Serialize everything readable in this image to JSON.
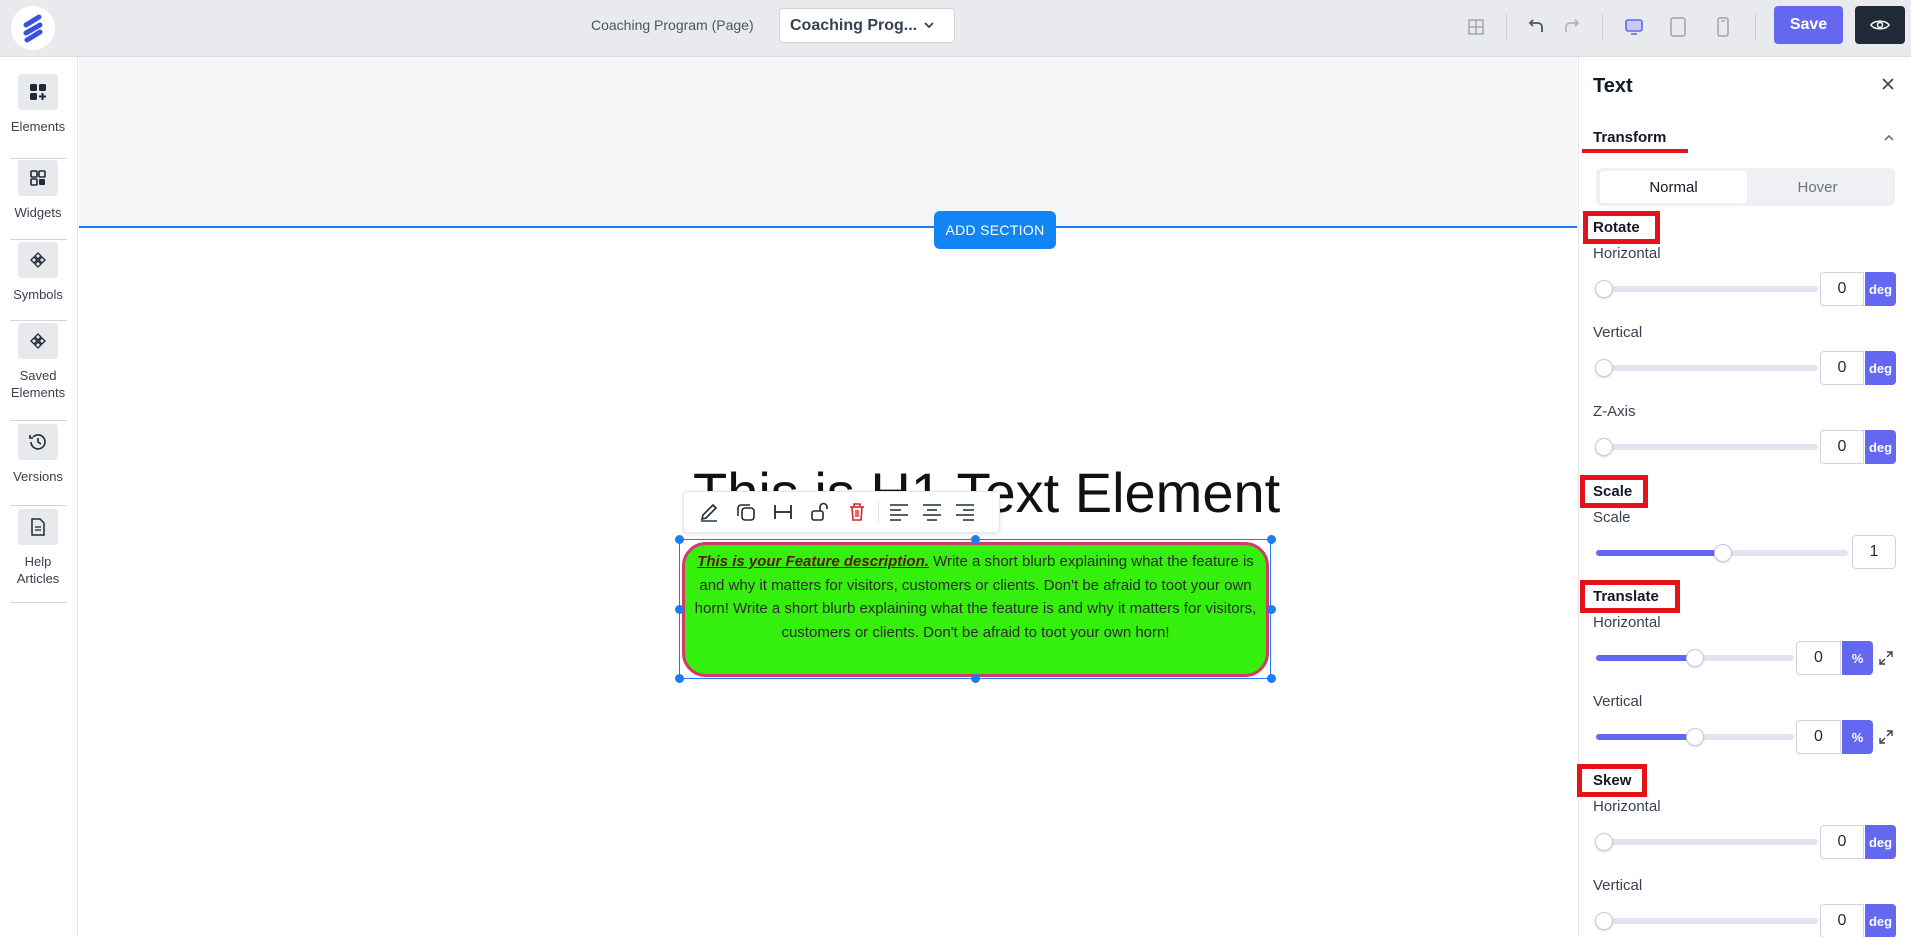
{
  "topbar": {
    "page_label": "Coaching Program (Page)",
    "page_select_value": "Coaching Prog...",
    "save_label": "Save"
  },
  "sidebar": {
    "items": [
      {
        "label": "Elements",
        "icon": "elements-icon"
      },
      {
        "label": "Widgets",
        "icon": "widgets-icon"
      },
      {
        "label": "Symbols",
        "icon": "symbols-icon"
      },
      {
        "label": "Saved Elements",
        "icon": "saved-elements-icon"
      },
      {
        "label": "Versions",
        "icon": "history-icon"
      },
      {
        "label": "Help Articles",
        "icon": "document-icon"
      }
    ]
  },
  "canvas": {
    "add_section_label": "ADD SECTION",
    "h1_text": "This is H1 Text Element",
    "feature_title": "This is your Feature description.",
    "feature_body": " Write a short blurb explaining what the feature is and why it matters for visitors, customers or clients. Don't be afraid to toot your own horn! Write a short blurb explaining what the feature is and why it matters for visitors, customers or clients. Don't be afraid to toot your own horn!",
    "colors": {
      "feature_bg": "#35f00d",
      "feature_border": "#d23a6a",
      "selection": "#1d7cf2"
    }
  },
  "panel": {
    "title": "Text",
    "section": "Transform",
    "states": {
      "normal": "Normal",
      "hover": "Hover"
    },
    "rotate": {
      "header": "Rotate",
      "horizontal": {
        "label": "Horizontal",
        "value": "0",
        "unit": "deg"
      },
      "vertical": {
        "label": "Vertical",
        "value": "0",
        "unit": "deg"
      },
      "z_axis": {
        "label": "Z-Axis",
        "value": "0",
        "unit": "deg"
      }
    },
    "scale": {
      "header": "Scale",
      "scale": {
        "label": "Scale",
        "value": "1"
      }
    },
    "translate": {
      "header": "Translate",
      "horizontal": {
        "label": "Horizontal",
        "value": "0",
        "unit": "%"
      },
      "vertical": {
        "label": "Vertical",
        "value": "0",
        "unit": "%"
      }
    },
    "skew": {
      "header": "Skew",
      "horizontal": {
        "label": "Horizontal",
        "value": "0",
        "unit": "deg"
      },
      "vertical": {
        "label": "Vertical",
        "value": "0",
        "unit": "deg"
      }
    },
    "accent_color": "#6468f0",
    "highlight_color": "#e5121b"
  }
}
